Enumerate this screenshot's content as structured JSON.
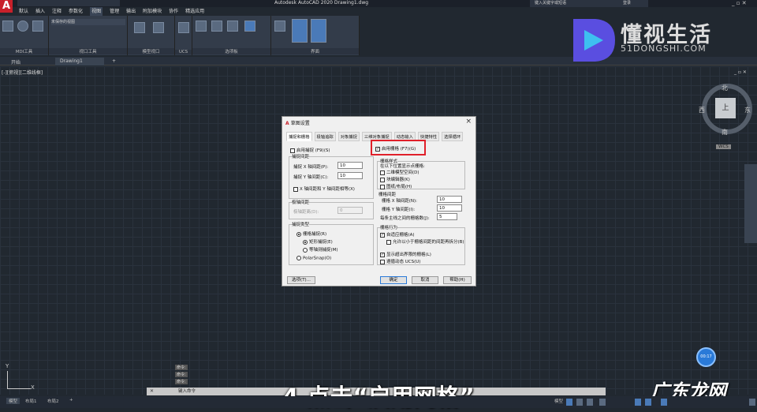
{
  "app": {
    "title": "Autodesk AutoCAD 2020  Drawing1.dwg",
    "logo_letter": "A",
    "search_placeholder": "键入关键字或短语",
    "user": "登录"
  },
  "menu": [
    "默认",
    "插入",
    "注释",
    "参数化",
    "视图",
    "管理",
    "输出",
    "附加模块",
    "协作",
    "精选应用"
  ],
  "menu_active": 4,
  "ribbon": {
    "panels": [
      "MDI工具",
      "视口工具",
      "模型视口",
      "UCS",
      "选项板",
      "界面"
    ],
    "style_field": "未保存的视图"
  },
  "doc_tabs": [
    "开始",
    "Drawing1"
  ],
  "viewport_label": "[-][俯视][二维线框]",
  "watermark": {
    "name": "懂视生活",
    "url": "51DONGSHI.COM",
    "corner": "广东龙网"
  },
  "viewcube": {
    "top": "上",
    "north": "北",
    "south": "南",
    "east": "东",
    "west": "西",
    "wcs": "WCS"
  },
  "dialog": {
    "title": "草图设置",
    "close": "×",
    "tabs": [
      "捕捉和栅格",
      "极轴追踪",
      "对象捕捉",
      "三维对象捕捉",
      "动态输入",
      "快捷特性",
      "选择循环"
    ],
    "snap_on": "启用捕捉 (F9)(S)",
    "snap_spacing": "捕捉间距",
    "snap_x_label": "捕捉 X 轴间距(P):",
    "snap_x": "10",
    "snap_y_label": "捕捉 Y 轴间距(C):",
    "snap_y": "10",
    "equal_xy": "X 轴间距和 Y 轴间距相等(X)",
    "polar_spacing": "极轴间距",
    "polar_distance_label": "极轴距离(D):",
    "polar_distance": "0",
    "snap_type": "捕捉类型",
    "grid_snap": "栅格捕捉(R)",
    "rect_snap": "矩形捕捉(E)",
    "iso_snap": "等轴测捕捉(M)",
    "polar_snap": "PolarSnap(O)",
    "grid_on": "启用栅格 (F7)(G)",
    "grid_style": "栅格样式",
    "dot_grid_in": "在以下位置显示点栅格:",
    "model_space": "二维模型空间(D)",
    "block_editor": "块编辑器(K)",
    "sheet_layout": "图纸/布局(H)",
    "grid_spacing": "栅格间距",
    "grid_x_label": "栅格 X 轴间距(N):",
    "grid_x": "10",
    "grid_y_label": "栅格 Y 轴间距(I):",
    "grid_y": "10",
    "major_label": "每条主线之间的栅格数(J):",
    "major": "5",
    "grid_behavior": "栅格行为",
    "adaptive": "自适应栅格(A)",
    "subdivide": "允许以小于栅格间距的间距再拆分(B)",
    "beyond_limits": "显示超出界限的栅格(L)",
    "follow_ucs": "遵循动态 UCS(U)",
    "options_btn": "选项(T)...",
    "ok_btn": "确定",
    "cancel_btn": "取消",
    "help_btn": "帮助(H)"
  },
  "command": {
    "placeholder": "键入命令",
    "history": [
      "命令:",
      "命令:",
      "命令:"
    ]
  },
  "layouts": [
    "模型",
    "布局1",
    "布局2",
    "+"
  ],
  "status": {
    "model": "模型",
    "time": "00:17"
  },
  "axes": {
    "x": "X",
    "y": "Y"
  },
  "subtitle": "4.点击“启用网格”",
  "colors": {
    "highlight": "#e0202a",
    "accent": "#2a7ad8"
  }
}
